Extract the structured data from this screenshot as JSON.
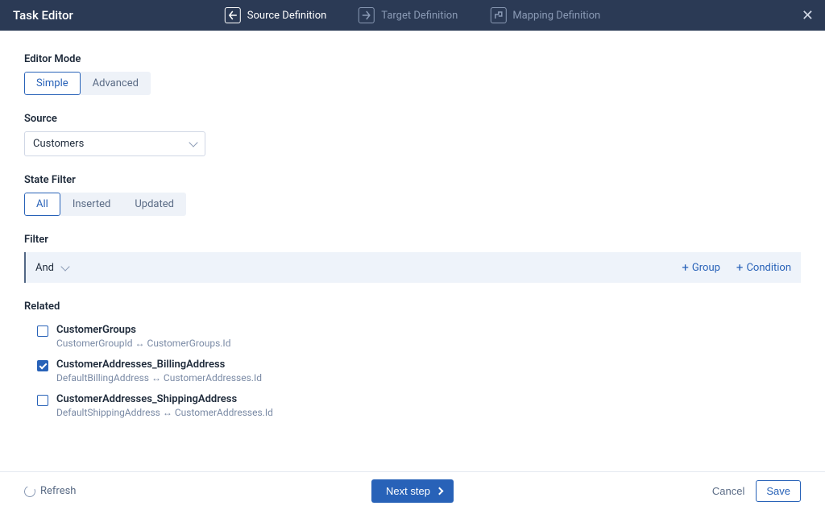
{
  "header": {
    "title": "Task Editor",
    "tabs": [
      {
        "label": "Source Definition",
        "active": true,
        "icon": "source"
      },
      {
        "label": "Target Definition",
        "active": false,
        "icon": "target"
      },
      {
        "label": "Mapping Definition",
        "active": false,
        "icon": "mapping"
      }
    ]
  },
  "editor_mode": {
    "label": "Editor Mode",
    "options": [
      "Simple",
      "Advanced"
    ],
    "selected": "Simple"
  },
  "source": {
    "label": "Source",
    "value": "Customers"
  },
  "state_filter": {
    "label": "State Filter",
    "options": [
      "All",
      "Inserted",
      "Updated"
    ],
    "selected": "All"
  },
  "filter": {
    "label": "Filter",
    "operator": "And",
    "add_group_label": "Group",
    "add_condition_label": "Condition"
  },
  "related": {
    "label": "Related",
    "items": [
      {
        "title": "CustomerGroups",
        "sub": "CustomerGroupId ↔ CustomerGroups.Id",
        "checked": false
      },
      {
        "title": "CustomerAddresses_BillingAddress",
        "sub": "DefaultBillingAddress ↔ CustomerAddresses.Id",
        "checked": true
      },
      {
        "title": "CustomerAddresses_ShippingAddress",
        "sub": "DefaultShippingAddress ↔ CustomerAddresses.Id",
        "checked": false
      }
    ]
  },
  "footer": {
    "refresh": "Refresh",
    "next": "Next step",
    "cancel": "Cancel",
    "save": "Save"
  }
}
